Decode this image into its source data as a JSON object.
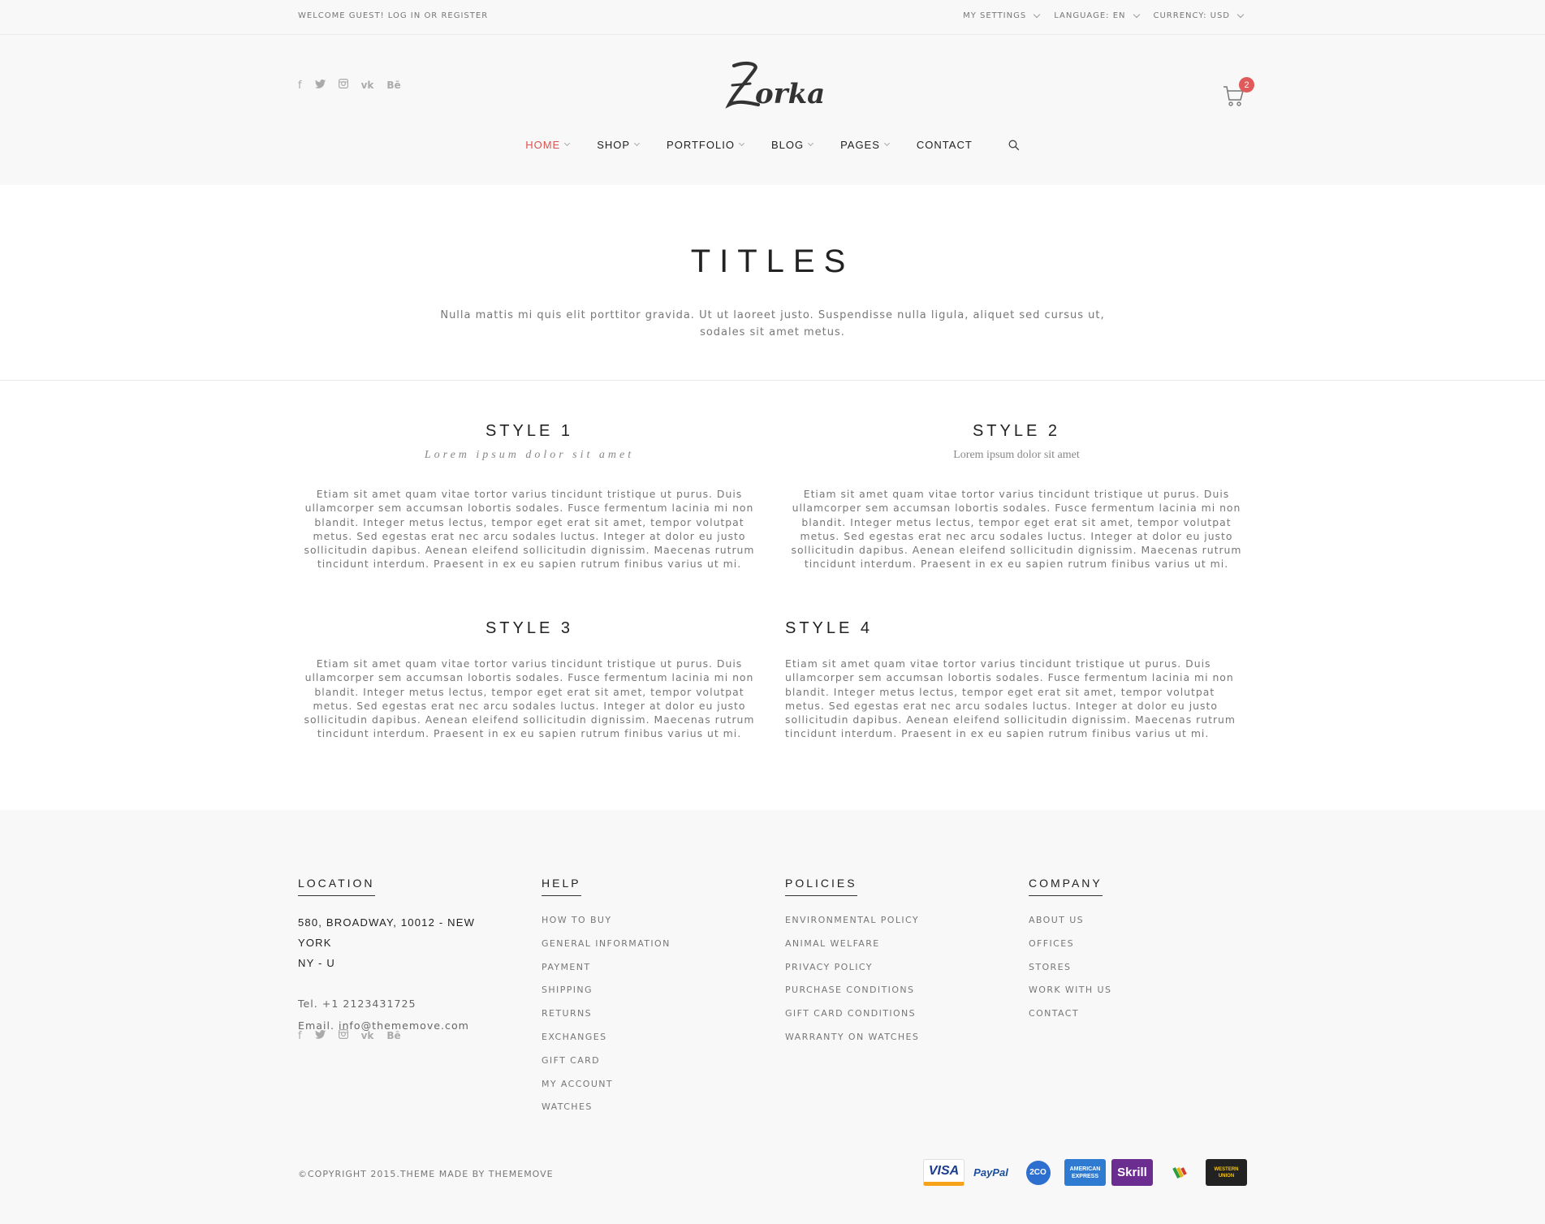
{
  "topbar": {
    "welcome": "WELCOME GUEST!",
    "login": "LOG IN",
    "or": "OR",
    "register": "REGISTER",
    "settings": "MY SETTINGS",
    "language": "LANGUAGE: EN",
    "currency": "CURRENCY: USD"
  },
  "header": {
    "logo_text": "Zorka",
    "cart_count": "2",
    "social_icons": [
      "facebook-icon",
      "twitter-icon",
      "instagram-icon",
      "vk-icon",
      "behance-icon"
    ]
  },
  "nav": {
    "items": [
      "HOME",
      "SHOP",
      "PORTFOLIO",
      "BLOG",
      "PAGES",
      "CONTACT"
    ],
    "active_color": "#d9534f"
  },
  "hero": {
    "title": "TITLES",
    "text": "Nulla mattis mi quis elit porttitor gravida. Ut ut laoreet justo. Suspendisse nulla ligula, aliquet sed cursus ut, sodales sit amet metus."
  },
  "styles": [
    {
      "title": "STYLE 1",
      "subtitle": "Lorem ipsum dolor sit amet",
      "body": "Etiam sit amet quam vitae tortor varius tincidunt tristique ut purus. Duis ullamcorper sem accumsan lobortis sodales. Fusce fermentum lacinia mi non blandit. Integer metus lectus, tempor eget erat sit amet, tempor volutpat metus. Sed egestas erat nec arcu sodales luctus. Integer at dolor eu justo sollicitudin dapibus. Aenean eleifend sollicitudin dignissim. Maecenas rutrum tincidunt interdum. Praesent in ex eu sapien rutrum finibus varius ut mi."
    },
    {
      "title": "STYLE 2",
      "subtitle": "Lorem ipsum dolor sit amet",
      "body": "Etiam sit amet quam vitae tortor varius tincidunt tristique ut purus. Duis ullamcorper sem accumsan lobortis sodales. Fusce fermentum lacinia mi non blandit. Integer metus lectus, tempor eget erat sit amet, tempor volutpat metus. Sed egestas erat nec arcu sodales luctus. Integer at dolor eu justo sollicitudin dapibus. Aenean eleifend sollicitudin dignissim. Maecenas rutrum tincidunt interdum. Praesent in ex eu sapien rutrum finibus varius ut mi."
    },
    {
      "title": "STYLE 3",
      "body": "Etiam sit amet quam vitae tortor varius tincidunt tristique ut purus. Duis ullamcorper sem accumsan lobortis sodales. Fusce fermentum lacinia mi non blandit. Integer metus lectus, tempor eget erat sit amet, tempor volutpat metus. Sed egestas erat nec arcu sodales luctus. Integer at dolor eu justo sollicitudin dapibus. Aenean eleifend sollicitudin dignissim. Maecenas rutrum tincidunt interdum. Praesent in ex eu sapien rutrum finibus varius ut mi."
    },
    {
      "title": "STYLE 4",
      "body": "Etiam sit amet quam vitae tortor varius tincidunt tristique ut purus. Duis ullamcorper sem accumsan lobortis sodales. Fusce fermentum lacinia mi non blandit. Integer metus lectus, tempor eget erat sit amet, tempor volutpat metus. Sed egestas erat nec arcu sodales luctus. Integer at dolor eu justo sollicitudin dapibus. Aenean eleifend sollicitudin dignissim. Maecenas rutrum tincidunt interdum. Praesent in ex eu sapien rutrum finibus varius ut mi."
    }
  ],
  "footer": {
    "location": {
      "title": "LOCATION",
      "address_line1": "580, BROADWAY, 10012 - NEW YORK",
      "address_line2": "NY - U",
      "tel": "Tel. +1 2123431725",
      "email": "Email. info@thememove.com"
    },
    "help": {
      "title": "HELP",
      "items": [
        "HOW TO BUY",
        "GENERAL INFORMATION",
        "PAYMENT",
        "SHIPPING",
        "RETURNS",
        "EXCHANGES",
        "GIFT CARD",
        "MY ACCOUNT",
        "WATCHES"
      ]
    },
    "policies": {
      "title": "POLICIES",
      "items": [
        "ENVIRONMENTAL POLICY",
        "ANIMAL WELFARE",
        "PRIVACY POLICY",
        "PURCHASE CONDITIONS",
        "GIFT CARD CONDITIONS",
        "WARRANTY ON WATCHES"
      ]
    },
    "company": {
      "title": "COMPANY",
      "items": [
        "ABOUT US",
        "OFFICES",
        "STORES",
        "WORK WITH US",
        "CONTACT"
      ]
    },
    "copyright": "©COPYRIGHT 2015.THEME MADE BY THEMEMOVE",
    "payments": [
      "VISA",
      "PayPal",
      "2CO",
      "AMERICAN EXPRESS",
      "Skrill",
      "Google Wallet",
      "WESTERN UNION"
    ]
  }
}
